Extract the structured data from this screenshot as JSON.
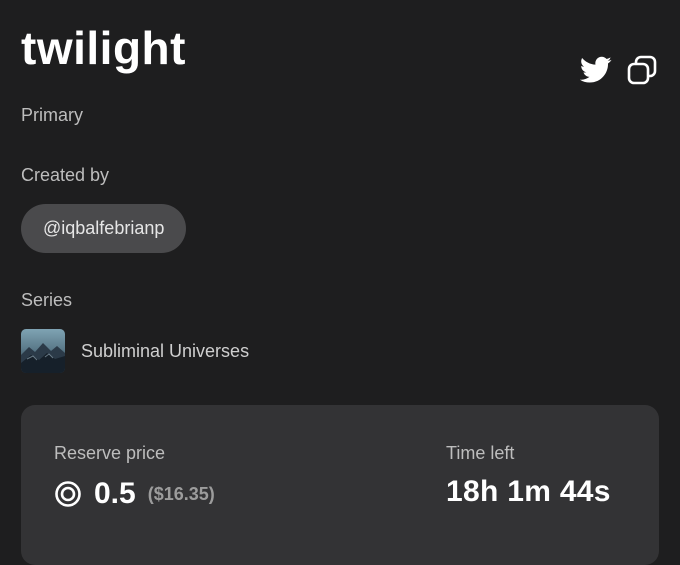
{
  "artwork": {
    "title": "twilight",
    "market": "Primary"
  },
  "creator": {
    "label": "Created by",
    "handle": "@iqbalfebrianp"
  },
  "series": {
    "label": "Series",
    "name": "Subliminal Universes"
  },
  "auction": {
    "reserve_label": "Reserve price",
    "reserve_value": "0.5",
    "reserve_usd": "($16.35)",
    "time_label": "Time left",
    "time_value": "18h 1m 44s"
  },
  "actions": {
    "share_icon": "twitter-icon",
    "copy_icon": "copy-icon"
  },
  "colors": {
    "background": "#1e1e1f",
    "card": "#333335",
    "pill": "#4a4a4c",
    "muted_text": "#bdbdbd"
  }
}
